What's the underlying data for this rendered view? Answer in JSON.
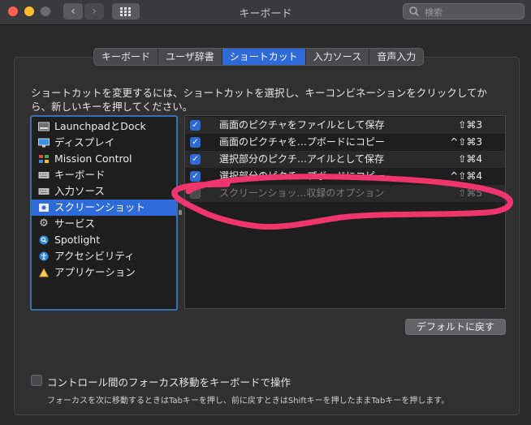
{
  "window": {
    "title": "キーボード"
  },
  "search": {
    "placeholder": "検索"
  },
  "tabs": [
    {
      "label": "キーボード",
      "active": false
    },
    {
      "label": "ユーザ辞書",
      "active": false
    },
    {
      "label": "ショートカット",
      "active": true
    },
    {
      "label": "入力ソース",
      "active": false
    },
    {
      "label": "音声入力",
      "active": false
    }
  ],
  "description": "ショートカットを変更するには、ショートカットを選択し、キーコンビネーションをクリックしてから、新しいキーを押してください。",
  "categories": [
    {
      "label": "LaunchpadとDock",
      "icon": "launchpad-icon",
      "selected": false
    },
    {
      "label": "ディスプレイ",
      "icon": "display-icon",
      "selected": false
    },
    {
      "label": "Mission Control",
      "icon": "mission-control-icon",
      "selected": false
    },
    {
      "label": "キーボード",
      "icon": "keyboard-icon",
      "selected": false
    },
    {
      "label": "入力ソース",
      "icon": "input-source-icon",
      "selected": false
    },
    {
      "label": "スクリーンショット",
      "icon": "screenshot-icon",
      "selected": true
    },
    {
      "label": "サービス",
      "icon": "gear-icon",
      "selected": false
    },
    {
      "label": "Spotlight",
      "icon": "spotlight-icon",
      "selected": false
    },
    {
      "label": "アクセシビリティ",
      "icon": "accessibility-icon",
      "selected": false
    },
    {
      "label": "アプリケーション",
      "icon": "apps-icon",
      "selected": false
    }
  ],
  "shortcuts": [
    {
      "name": "画面のピクチャをファイルとして保存",
      "key": "⇧⌘3",
      "checked": true
    },
    {
      "name": "画面のピクチャを…プボードにコピー",
      "key": "^⇧⌘3",
      "checked": true
    },
    {
      "name": "選択部分のピクチ…アイルとして保存",
      "key": "⇧⌘4",
      "checked": true
    },
    {
      "name": "選択部分のピクチ…プボードにコピー",
      "key": "^⇧⌘4",
      "checked": true
    },
    {
      "name": "スクリーンショッ…収録のオプション",
      "key": "⇧⌘5",
      "checked": false
    }
  ],
  "defaults_button": "デフォルトに戻す",
  "focus_toggle": {
    "label": "コントロール間のフォーカス移動をキーボードで操作",
    "note": "フォーカスを次に移動するときはTabキーを押し、前に戻すときはShiftキーを押したままTabキーを押します。",
    "checked": false
  },
  "colors": {
    "accent": "#2f6bd8",
    "annotation": "#f0356e"
  }
}
